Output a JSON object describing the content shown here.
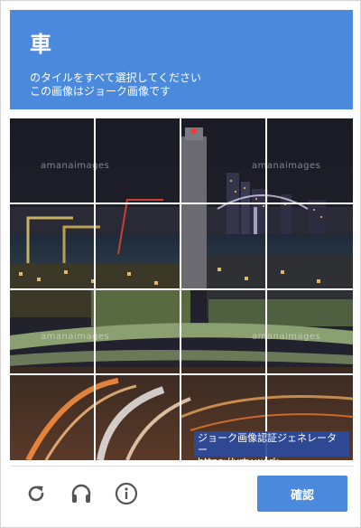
{
  "header": {
    "keyword": "車",
    "instruction_line1": "のタイルをすべて選択してください",
    "instruction_line2": "この画像はジョーク画像です"
  },
  "image": {
    "watermark": "amanaimages",
    "credit_line1": "ジョーク画像認証ジェネレーター",
    "credit_line2": "https://vrty.work"
  },
  "grid": {
    "rows": 4,
    "cols": 4
  },
  "footer": {
    "reload_icon": "reload-icon",
    "audio_icon": "headphones-icon",
    "info_icon": "info-icon",
    "verify_label": "確認"
  },
  "colors": {
    "accent": "#4a89dc",
    "icon": "#555555"
  }
}
